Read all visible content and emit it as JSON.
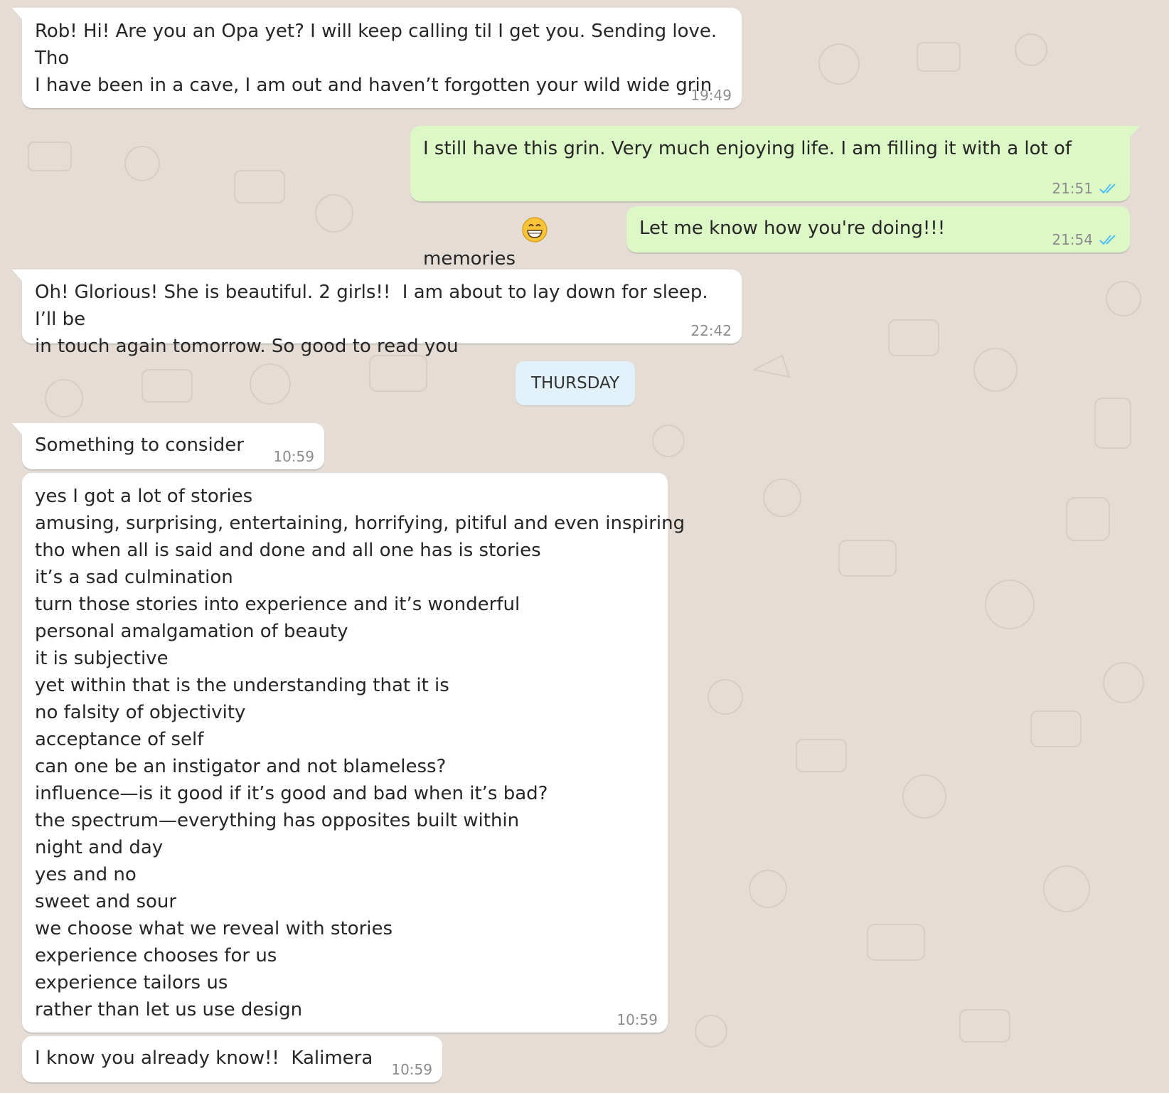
{
  "chat": {
    "background_color": "#e5ddd5",
    "incoming_color": "#ffffff",
    "outgoing_color": "#dcf8c6",
    "tick_color": "#4fc3f7",
    "messages": [
      {
        "direction": "in",
        "text": "Rob! Hi! Are you an Opa yet? I will keep calling til I get you. Sending love. Tho\nI have been in a cave, I am out and haven’t forgotten your wild wide grin",
        "time": "19:49"
      },
      {
        "direction": "out",
        "text": "I still have this grin. Very much enjoying life. I am filling it with a lot of\nmemories",
        "emoji": "grinning-face-with-smiling-eyes",
        "time": "21:51",
        "status": "read"
      },
      {
        "direction": "out",
        "text": "Let me know how you're doing!!!",
        "time": "21:54",
        "status": "read"
      },
      {
        "direction": "in",
        "text": "Oh! Glorious! She is beautiful. 2 girls!!  I am about to lay down for sleep. I’ll be\nin touch again tomorrow. So good to read you",
        "time": "22:42"
      }
    ],
    "day_separator": "THURSDAY",
    "thursday_messages": [
      {
        "direction": "in",
        "text": "Something to consider",
        "time": "10:59"
      },
      {
        "direction": "in",
        "lines": [
          "yes I got a lot of stories",
          "amusing, surprising, entertaining, horrifying, pitiful and even inspiring",
          "tho when all is said and done and all one has is stories",
          "it’s a sad culmination",
          "turn those stories into experience and it’s wonderful",
          "personal amalgamation of beauty",
          "it is subjective",
          "yet within that is the understanding that it is",
          "no falsity of objectivity",
          "acceptance of self",
          "can one be an instigator and not blameless?",
          "influence—is it good if it’s good and bad when it’s bad?",
          "the spectrum—everything has opposites built within",
          "night and day",
          "yes and no",
          "sweet and sour",
          "we choose what we reveal with stories",
          "experience chooses for us",
          "experience tailors us",
          "rather than let us use design"
        ],
        "time": "10:59"
      },
      {
        "direction": "in",
        "text": "I know you already know!!  Kalimera",
        "time": "10:59"
      }
    ]
  }
}
